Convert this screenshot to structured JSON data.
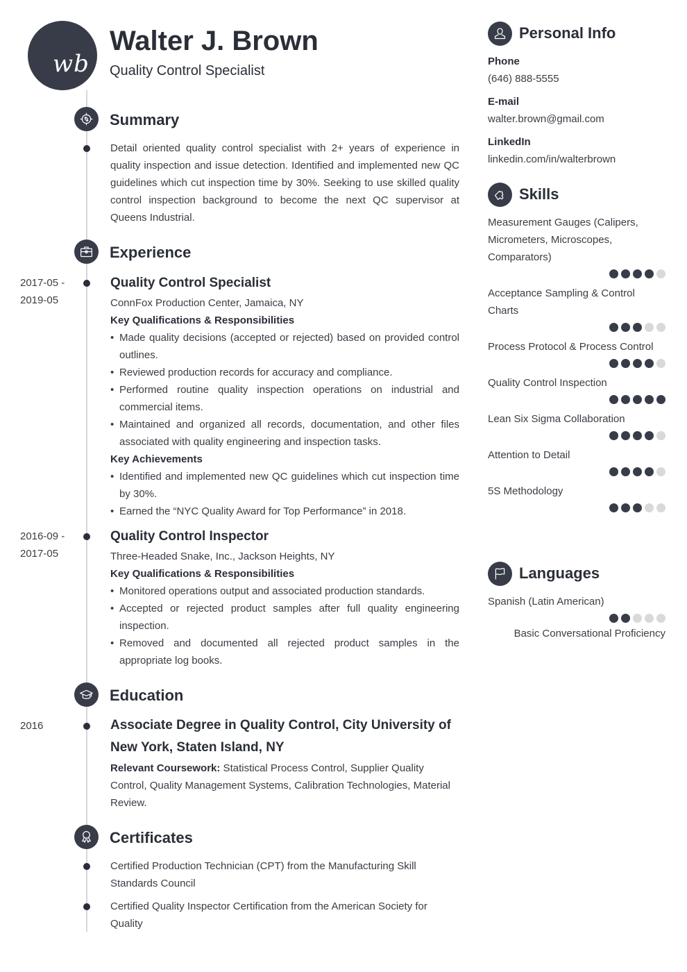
{
  "header": {
    "initials": "wb",
    "name": "Walter J. Brown",
    "title": "Quality Control Specialist"
  },
  "summary": {
    "heading": "Summary",
    "icon": "target-icon",
    "text": "Detail oriented quality control specialist with 2+ years of experience in quality inspection and issue detection. Identified and implemented new QC guidelines which cut inspection time by 30%. Seeking to use skilled quality control inspection background to become the next QC supervisor at Queens Industrial."
  },
  "experience": {
    "heading": "Experience",
    "icon": "briefcase-icon",
    "jobs": [
      {
        "date_start": "2017-05 -",
        "date_end": "2019-05",
        "title": "Quality Control Specialist",
        "company": "ConnFox Production Center, Jamaica, NY",
        "resp_heading": "Key Qualifications & Responsibilities",
        "responsibilities": [
          "Made quality decisions (accepted or rejected) based on provided control outlines.",
          "Reviewed production records for accuracy and compliance.",
          "Performed routine quality inspection operations on industrial and commercial items.",
          "Maintained and organized all records, documentation, and other files associated with quality engineering and inspection tasks."
        ],
        "ach_heading": "Key Achievements",
        "achievements": [
          "Identified and implemented new QC guidelines which cut inspection time by 30%.",
          "Earned the “NYC Quality Award for Top Performance” in 2018."
        ]
      },
      {
        "date_start": "2016-09 -",
        "date_end": "2017-05",
        "title": "Quality Control Inspector",
        "company": "Three-Headed Snake, Inc., Jackson Heights, NY",
        "resp_heading": "Key Qualifications & Responsibilities",
        "responsibilities": [
          "Monitored operations output and associated production standards.",
          "Accepted or rejected product samples after full quality engineering inspection.",
          "Removed and documented all rejected product samples in the appropriate log books."
        ]
      }
    ]
  },
  "education": {
    "heading": "Education",
    "icon": "graduation-cap-icon",
    "items": [
      {
        "date": "2016",
        "degree": "Associate Degree in Quality Control, City University of New York, Staten Island, NY",
        "coursework_label": "Relevant Coursework:",
        "coursework": " Statistical Process Control, Supplier Quality Control, Quality Management Systems, Calibration Technologies, Material Review."
      }
    ]
  },
  "certificates": {
    "heading": "Certificates",
    "icon": "award-ribbon-icon",
    "items": [
      "Certified Production Technician (CPT) from the Manufacturing Skill Standards Council",
      "Certified Quality Inspector Certification from the American Society for Quality"
    ]
  },
  "personal_info": {
    "heading": "Personal Info",
    "icon": "user-icon",
    "fields": [
      {
        "label": "Phone",
        "value": "(646) 888-5555"
      },
      {
        "label": "E-mail",
        "value": "walter.brown@gmail.com"
      },
      {
        "label": "LinkedIn",
        "value": "linkedin.com/in/walterbrown"
      }
    ]
  },
  "skills": {
    "heading": "Skills",
    "icon": "puzzle-piece-icon",
    "max_rating": 5,
    "items": [
      {
        "name": "Measurement Gauges (Calipers, Micrometers, Microscopes, Comparators)",
        "rating": 4
      },
      {
        "name": "Acceptance Sampling & Control Charts",
        "rating": 3
      },
      {
        "name": "Process Protocol & Process Control",
        "rating": 4
      },
      {
        "name": "Quality Control Inspection",
        "rating": 5
      },
      {
        "name": "Lean Six Sigma Collaboration",
        "rating": 4
      },
      {
        "name": "Attention to Detail",
        "rating": 4
      },
      {
        "name": "5S Methodology",
        "rating": 3
      }
    ]
  },
  "languages": {
    "heading": "Languages",
    "icon": "flag-icon",
    "max_rating": 5,
    "items": [
      {
        "name": "Spanish (Latin American)",
        "rating": 2,
        "level": "Basic Conversational Proficiency"
      }
    ]
  },
  "colors": {
    "accent": "#373c48",
    "text": "#3a3d44",
    "heading": "#2a2e38",
    "rating_off": "#d9d9d9",
    "timeline": "#d6d6d6"
  }
}
